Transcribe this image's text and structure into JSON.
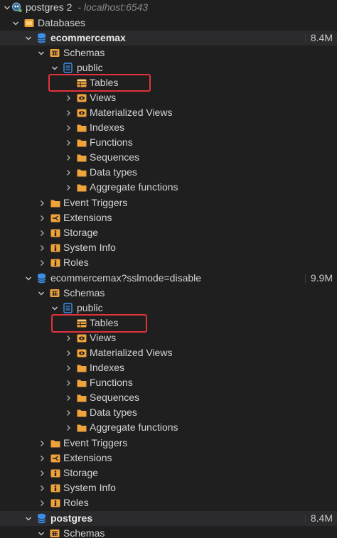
{
  "colors": {
    "background": "#1f1f20",
    "db_row_background": "#2b2b2d",
    "folder_orange": "#f0a23b",
    "db_blue": "#3d8ee8",
    "highlight_red": "#e2333b",
    "text": "#d4d4d4"
  },
  "connection": {
    "name": "postgres 2",
    "host": "- localhost:6543",
    "icon": "postgres-connection-icon"
  },
  "databases_folder": {
    "label": "Databases",
    "icon": "databases-folder-icon"
  },
  "databases": [
    {
      "name": "ecommercemax",
      "size": "8.4M",
      "schemas_label": "Schemas",
      "schema": {
        "name": "public",
        "items": [
          {
            "label": "Tables",
            "icon": "tables-icon"
          },
          {
            "label": "Views",
            "icon": "views-icon"
          },
          {
            "label": "Materialized Views",
            "icon": "materialized-views-icon"
          },
          {
            "label": "Indexes",
            "icon": "folder-icon"
          },
          {
            "label": "Functions",
            "icon": "folder-icon"
          },
          {
            "label": "Sequences",
            "icon": "folder-icon"
          },
          {
            "label": "Data types",
            "icon": "folder-icon"
          },
          {
            "label": "Aggregate functions",
            "icon": "folder-icon"
          }
        ]
      },
      "extras": [
        {
          "label": "Event Triggers",
          "icon": "folder-icon"
        },
        {
          "label": "Extensions",
          "icon": "extensions-icon"
        },
        {
          "label": "Storage",
          "icon": "storage-icon"
        },
        {
          "label": "System Info",
          "icon": "system-info-icon"
        },
        {
          "label": "Roles",
          "icon": "roles-icon"
        }
      ]
    },
    {
      "name": "ecommercemax?sslmode=disable",
      "size": "9.9M",
      "schemas_label": "Schemas",
      "schema": {
        "name": "public",
        "items": [
          {
            "label": "Tables",
            "icon": "tables-icon"
          },
          {
            "label": "Views",
            "icon": "views-icon"
          },
          {
            "label": "Materialized Views",
            "icon": "materialized-views-icon"
          },
          {
            "label": "Indexes",
            "icon": "folder-icon"
          },
          {
            "label": "Functions",
            "icon": "folder-icon"
          },
          {
            "label": "Sequences",
            "icon": "folder-icon"
          },
          {
            "label": "Data types",
            "icon": "folder-icon"
          },
          {
            "label": "Aggregate functions",
            "icon": "folder-icon"
          }
        ]
      },
      "extras": [
        {
          "label": "Event Triggers",
          "icon": "folder-icon"
        },
        {
          "label": "Extensions",
          "icon": "extensions-icon"
        },
        {
          "label": "Storage",
          "icon": "storage-icon"
        },
        {
          "label": "System Info",
          "icon": "system-info-icon"
        },
        {
          "label": "Roles",
          "icon": "roles-icon"
        }
      ]
    },
    {
      "name": "postgres",
      "size": "8.4M",
      "schemas_label": "Schemas"
    }
  ]
}
